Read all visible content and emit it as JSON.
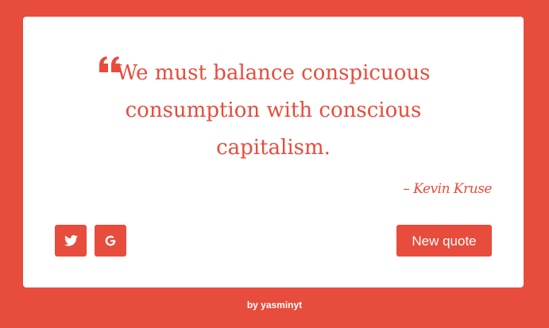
{
  "colors": {
    "accent": "#e74c3c",
    "card": "#ffffff",
    "button_text": "#ffffff"
  },
  "quote": {
    "icon": "quote-left-icon",
    "text": "We must balance conspicuous consumption with conscious capitalism."
  },
  "author": "– Kevin Kruse",
  "share": {
    "twitter_icon": "twitter-icon",
    "google_icon": "google-icon"
  },
  "buttons": {
    "new_quote_label": "New quote"
  },
  "footer": {
    "credit": "by yasminyt"
  }
}
